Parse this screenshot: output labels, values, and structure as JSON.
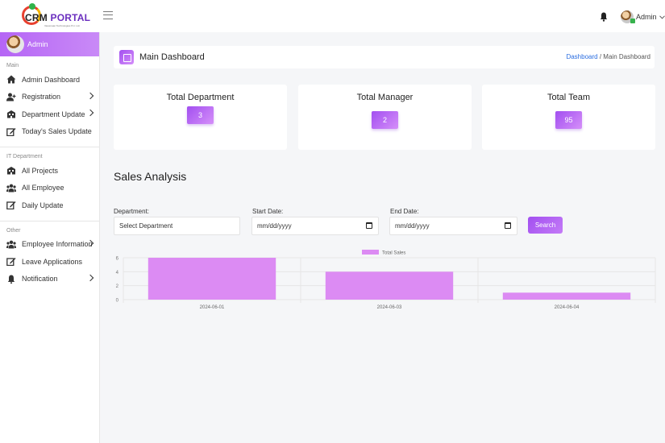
{
  "brand": {
    "name_prefix": "CRM",
    "name_suffix": "PORTAL",
    "tagline": "Vasumaan Technologies Pvt. Ltd."
  },
  "topbar": {
    "user_label": "Admin"
  },
  "sidebar": {
    "user_label": "Admin",
    "sections": [
      {
        "title": "Main",
        "items": [
          {
            "label": "Admin Dashboard",
            "icon": "home-icon",
            "has_chevron": false
          },
          {
            "label": "Registration",
            "icon": "user-plus-icon",
            "has_chevron": true
          },
          {
            "label": "Department Update",
            "icon": "building-icon",
            "has_chevron": true
          },
          {
            "label": "Today's Sales Update",
            "icon": "edit-icon",
            "has_chevron": false
          }
        ]
      },
      {
        "title": "IT Department",
        "items": [
          {
            "label": "All Projects",
            "icon": "building-icon",
            "has_chevron": false
          },
          {
            "label": "All Employee",
            "icon": "users-icon",
            "has_chevron": false
          },
          {
            "label": "Daily Update",
            "icon": "edit-icon",
            "has_chevron": false
          }
        ]
      },
      {
        "title": "Other",
        "items": [
          {
            "label": "Employee Information",
            "icon": "users-icon",
            "has_chevron": true
          },
          {
            "label": "Leave Applications",
            "icon": "edit-icon",
            "has_chevron": false
          },
          {
            "label": "Notification",
            "icon": "bell-icon",
            "has_chevron": true
          }
        ]
      }
    ]
  },
  "header": {
    "title": "Main Dashboard",
    "breadcrumb_link": "Dashboard",
    "breadcrumb_sep": "/",
    "breadcrumb_current": "Main Dashboard"
  },
  "stats": [
    {
      "label": "Total Department",
      "value": "3"
    },
    {
      "label": "Total Manager",
      "value": "2"
    },
    {
      "label": "Total Team",
      "value": "95"
    }
  ],
  "sales": {
    "title": "Sales Analysis",
    "department_label": "Department:",
    "department_value": "Select Department",
    "start_label": "Start Date:",
    "start_placeholder": "mm/dd/yyyy",
    "end_label": "End Date:",
    "end_placeholder": "mm/dd/yyyy",
    "search_label": "Search"
  },
  "colors": {
    "accent": "#b565f5",
    "bar": "#dc8bf3",
    "link": "#2a6de0"
  },
  "chart_data": {
    "type": "bar",
    "categories": [
      "2024-06-01",
      "2024-06-03",
      "2024-06-04"
    ],
    "series": [
      {
        "name": "Total Sales",
        "values": [
          6,
          4,
          1
        ]
      }
    ],
    "yticks": [
      0,
      2,
      4,
      6
    ],
    "ylim": [
      0,
      6
    ],
    "legend": "top-center",
    "grid": true
  }
}
